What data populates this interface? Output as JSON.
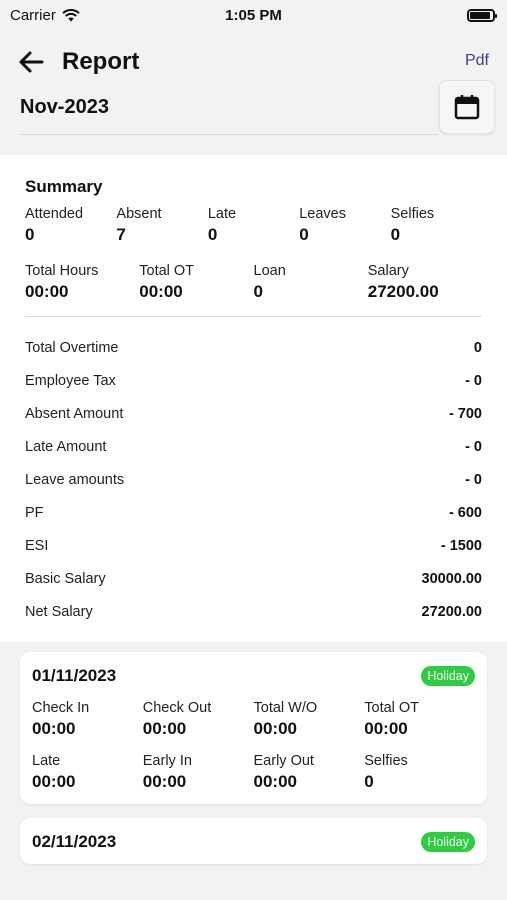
{
  "status_bar": {
    "carrier": "Carrier",
    "time": "1:05 PM",
    "battery_level": 0.92
  },
  "header": {
    "title": "Report",
    "pdf_label": "Pdf",
    "month": "Nov-2023"
  },
  "summary": {
    "title": "Summary",
    "stats_row1": [
      {
        "label": "Attended",
        "value": "0"
      },
      {
        "label": "Absent",
        "value": "7"
      },
      {
        "label": "Late",
        "value": "0"
      },
      {
        "label": "Leaves",
        "value": "0"
      },
      {
        "label": "Selfies",
        "value": "0"
      }
    ],
    "stats_row2": [
      {
        "label": "Total Hours",
        "value": "00:00"
      },
      {
        "label": "Total OT",
        "value": "00:00"
      },
      {
        "label": "Loan",
        "value": "0"
      },
      {
        "label": "Salary",
        "value": "27200.00"
      }
    ],
    "line_items": [
      {
        "label": "Total Overtime",
        "value": "0"
      },
      {
        "label": "Employee Tax",
        "value": "- 0"
      },
      {
        "label": "Absent Amount",
        "value": "- 700"
      },
      {
        "label": "Late Amount",
        "value": "- 0"
      },
      {
        "label": "Leave amounts",
        "value": "- 0"
      },
      {
        "label": "PF",
        "value": "- 600"
      },
      {
        "label": "ESI",
        "value": "- 1500"
      },
      {
        "label": "Basic Salary",
        "value": "30000.00"
      },
      {
        "label": "Net Salary",
        "value": "27200.00"
      }
    ]
  },
  "days": [
    {
      "date": "01/11/2023",
      "badge": "Holiday",
      "cells": [
        {
          "label": "Check In",
          "value": "00:00"
        },
        {
          "label": "Check Out",
          "value": "00:00"
        },
        {
          "label": "Total W/O",
          "value": "00:00"
        },
        {
          "label": "Total OT",
          "value": "00:00"
        },
        {
          "label": "Late",
          "value": "00:00"
        },
        {
          "label": "Early In",
          "value": "00:00"
        },
        {
          "label": "Early Out",
          "value": "00:00"
        },
        {
          "label": "Selfies",
          "value": "0"
        }
      ]
    },
    {
      "date": "02/11/2023",
      "badge": "Holiday",
      "cells": []
    }
  ],
  "colors": {
    "accent_link": "#3b3f8c",
    "holiday_badge": "#2ecc40"
  },
  "icons": {
    "back": "arrow-left-icon",
    "calendar": "calendar-icon",
    "wifi": "wifi-icon",
    "battery": "battery-icon"
  }
}
